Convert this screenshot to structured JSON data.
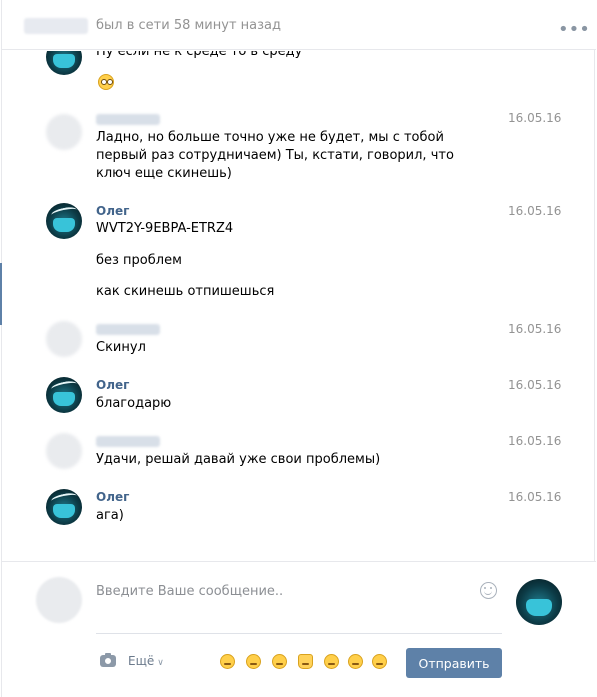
{
  "header": {
    "status": "был в сети 58 минут назад",
    "more_icon": "ellipsis-icon",
    "more_glyph": "•••"
  },
  "messages": [
    {
      "author": "",
      "date": "",
      "lines": [
        "Ну если не к среде то в среду"
      ],
      "emoji": "flushed-face"
    },
    {
      "author": "",
      "date": "16.05.16",
      "lines": [
        "Ладно, но больше точно уже не будет, мы с тобой первый раз сотрудничаем) Ты, кстати, говорил, что ключ еще скинешь)"
      ]
    },
    {
      "author": "Олег",
      "date": "16.05.16",
      "lines": [
        "WVT2Y-9EBPA-ETRZ4",
        "без проблем",
        "как скинешь отпишешься"
      ]
    },
    {
      "author": "",
      "date": "16.05.16",
      "lines": [
        "Скинул"
      ]
    },
    {
      "author": "Олег",
      "date": "16.05.16",
      "lines": [
        "благодарю"
      ]
    },
    {
      "author": "",
      "date": "16.05.16",
      "lines": [
        "Удачи, решай давай уже свои проблемы)"
      ]
    },
    {
      "author": "Олег",
      "date": "16.05.16",
      "lines": [
        "ага)"
      ]
    }
  ],
  "composer": {
    "placeholder": "Введите Ваше сообщение..",
    "value": "",
    "more_label": "Ещё",
    "send_label": "Отправить",
    "camera_icon": "camera-icon",
    "smile_icon": "smile-icon",
    "quick_emojis": [
      "smirking-face",
      "kissing-face",
      "unamused-face",
      "thumbs-up",
      "confused-face",
      "blushing-face",
      "relieved-face"
    ]
  },
  "colors": {
    "accent": "#5e81a8",
    "author_link": "#42648b",
    "meta_text": "#939393"
  }
}
